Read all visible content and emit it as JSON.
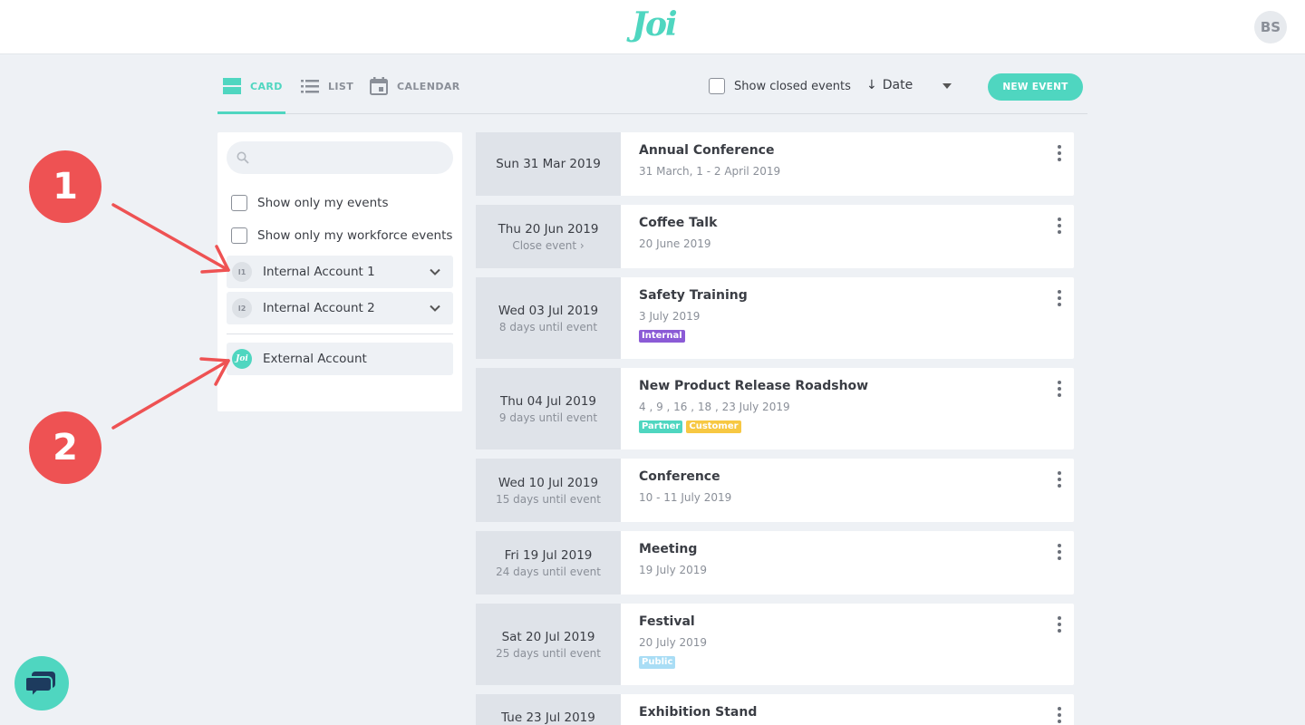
{
  "header": {
    "logo": "Joi",
    "user_initials": "BS"
  },
  "toolbar": {
    "tabs": [
      {
        "label": "CARD",
        "icon": "card-view-icon",
        "active": true
      },
      {
        "label": "LIST",
        "icon": "list-view-icon",
        "active": false
      },
      {
        "label": "CALENDAR",
        "icon": "calendar-icon",
        "active": false
      }
    ],
    "show_closed_label": "Show closed events",
    "sort_label": "Date",
    "new_event_label": "NEW EVENT",
    "accent_color": "#4fd6c0"
  },
  "sidebar": {
    "search_placeholder": "",
    "filters": [
      {
        "label": "Show only my events"
      },
      {
        "label": "Show only my workforce events"
      }
    ],
    "accounts": [
      {
        "badge": "I1",
        "name": "Internal Account 1"
      },
      {
        "badge": "I2",
        "name": "Internal Account 2"
      }
    ],
    "external_account": {
      "badge": "Joi",
      "name": "External Account"
    }
  },
  "annotations": [
    {
      "number": "1"
    },
    {
      "number": "2"
    }
  ],
  "events": [
    {
      "date": "Sun 31 Mar 2019",
      "relative": "",
      "title": "Annual Conference",
      "dates": "31 March, 1 - 2 April 2019",
      "tags": []
    },
    {
      "date": "Thu 20 Jun 2019",
      "relative": "Close event ›",
      "title": "Coffee Talk",
      "dates": "20 June 2019",
      "tags": []
    },
    {
      "date": "Wed 03 Jul 2019",
      "relative": "8 days until event",
      "title": "Safety Training",
      "dates": "3 July 2019",
      "tags": [
        {
          "label": "Internal",
          "color": "#8b5bd6"
        }
      ]
    },
    {
      "date": "Thu 04 Jul 2019",
      "relative": "9 days until event",
      "title": "New Product Release Roadshow",
      "dates": "4 , 9 , 16 , 18 , 23 July 2019",
      "tags": [
        {
          "label": "Partner",
          "color": "#4fd6c0"
        },
        {
          "label": "Customer",
          "color": "#f7c843"
        }
      ]
    },
    {
      "date": "Wed 10 Jul 2019",
      "relative": "15 days until event",
      "title": "Conference",
      "dates": "10 - 11 July 2019",
      "tags": []
    },
    {
      "date": "Fri 19 Jul 2019",
      "relative": "24 days until event",
      "title": "Meeting",
      "dates": "19 July 2019",
      "tags": []
    },
    {
      "date": "Sat 20 Jul 2019",
      "relative": "25 days until event",
      "title": "Festival",
      "dates": "20 July 2019",
      "tags": [
        {
          "label": "Public",
          "color": "#a9ddf5"
        }
      ]
    },
    {
      "date": "Tue 23 Jul 2019",
      "relative": "",
      "title": "Exhibition Stand",
      "dates": "",
      "tags": []
    }
  ]
}
